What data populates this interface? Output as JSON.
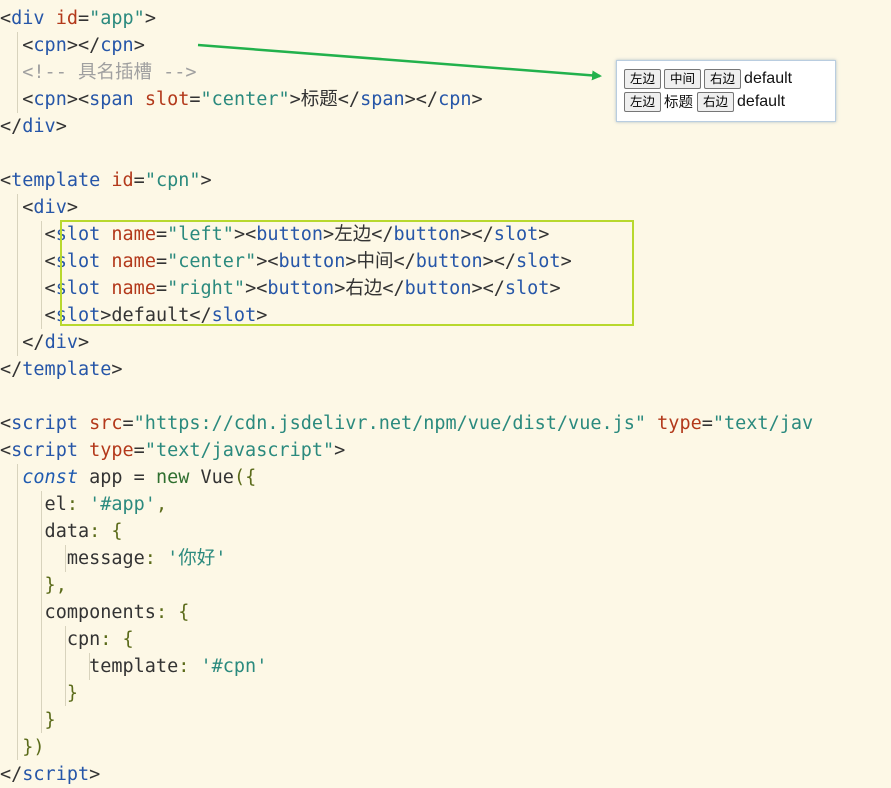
{
  "code_lines": [
    [
      [
        "p",
        "<"
      ],
      [
        "t",
        "div"
      ],
      [
        "p",
        " "
      ],
      [
        "a",
        "id"
      ],
      [
        "p",
        "="
      ],
      [
        "s",
        "\"app\""
      ],
      [
        "p",
        ">"
      ]
    ],
    [
      [
        "p",
        "  <"
      ],
      [
        "t",
        "cpn"
      ],
      [
        "p",
        "></"
      ],
      [
        "t",
        "cpn"
      ],
      [
        "p",
        ">"
      ]
    ],
    [
      [
        "c",
        "  <!-- 具名插槽 -->"
      ]
    ],
    [
      [
        "p",
        "  <"
      ],
      [
        "t",
        "cpn"
      ],
      [
        "p",
        "><"
      ],
      [
        "t",
        "span"
      ],
      [
        "p",
        " "
      ],
      [
        "a",
        "slot"
      ],
      [
        "p",
        "="
      ],
      [
        "s",
        "\"center\""
      ],
      [
        "p",
        ">"
      ],
      [
        "n",
        "标题"
      ],
      [
        "p",
        "</"
      ],
      [
        "t",
        "span"
      ],
      [
        "p",
        "></"
      ],
      [
        "t",
        "cpn"
      ],
      [
        "p",
        ">"
      ]
    ],
    [
      [
        "p",
        "</"
      ],
      [
        "t",
        "div"
      ],
      [
        "p",
        ">"
      ]
    ],
    [],
    [
      [
        "p",
        "<"
      ],
      [
        "t",
        "template"
      ],
      [
        "p",
        " "
      ],
      [
        "a",
        "id"
      ],
      [
        "p",
        "="
      ],
      [
        "s",
        "\"cpn\""
      ],
      [
        "p",
        ">"
      ]
    ],
    [
      [
        "p",
        "  <"
      ],
      [
        "t",
        "div"
      ],
      [
        "p",
        ">"
      ]
    ],
    [
      [
        "p",
        "    <"
      ],
      [
        "t",
        "slot"
      ],
      [
        "p",
        " "
      ],
      [
        "a",
        "name"
      ],
      [
        "p",
        "="
      ],
      [
        "s",
        "\"left\""
      ],
      [
        "p",
        "><"
      ],
      [
        "t",
        "button"
      ],
      [
        "p",
        ">"
      ],
      [
        "n",
        "左边"
      ],
      [
        "p",
        "</"
      ],
      [
        "t",
        "button"
      ],
      [
        "p",
        "></"
      ],
      [
        "t",
        "slot"
      ],
      [
        "p",
        ">"
      ]
    ],
    [
      [
        "p",
        "    <"
      ],
      [
        "t",
        "slot"
      ],
      [
        "p",
        " "
      ],
      [
        "a",
        "name"
      ],
      [
        "p",
        "="
      ],
      [
        "s",
        "\"center\""
      ],
      [
        "p",
        "><"
      ],
      [
        "t",
        "button"
      ],
      [
        "p",
        ">"
      ],
      [
        "n",
        "中间"
      ],
      [
        "p",
        "</"
      ],
      [
        "t",
        "button"
      ],
      [
        "p",
        "></"
      ],
      [
        "t",
        "slot"
      ],
      [
        "p",
        ">"
      ]
    ],
    [
      [
        "p",
        "    <"
      ],
      [
        "t",
        "slot"
      ],
      [
        "p",
        " "
      ],
      [
        "a",
        "name"
      ],
      [
        "p",
        "="
      ],
      [
        "s",
        "\"right\""
      ],
      [
        "p",
        "><"
      ],
      [
        "t",
        "button"
      ],
      [
        "p",
        ">"
      ],
      [
        "n",
        "右边"
      ],
      [
        "p",
        "</"
      ],
      [
        "t",
        "button"
      ],
      [
        "p",
        "></"
      ],
      [
        "t",
        "slot"
      ],
      [
        "p",
        ">"
      ]
    ],
    [
      [
        "p",
        "    <"
      ],
      [
        "t",
        "slot"
      ],
      [
        "p",
        ">"
      ],
      [
        "n",
        "default"
      ],
      [
        "p",
        "</"
      ],
      [
        "t",
        "slot"
      ],
      [
        "p",
        ">"
      ]
    ],
    [
      [
        "p",
        "  </"
      ],
      [
        "t",
        "div"
      ],
      [
        "p",
        ">"
      ]
    ],
    [
      [
        "p",
        "</"
      ],
      [
        "t",
        "template"
      ],
      [
        "p",
        ">"
      ]
    ],
    [],
    [
      [
        "p",
        "<"
      ],
      [
        "t",
        "script"
      ],
      [
        "p",
        " "
      ],
      [
        "a",
        "src"
      ],
      [
        "p",
        "="
      ],
      [
        "s",
        "\"https://cdn.jsdelivr.net/npm/vue/dist/vue.js\""
      ],
      [
        "p",
        " "
      ],
      [
        "a",
        "type"
      ],
      [
        "p",
        "="
      ],
      [
        "s",
        "\"text/jav"
      ]
    ],
    [
      [
        "p",
        "<"
      ],
      [
        "t",
        "script"
      ],
      [
        "p",
        " "
      ],
      [
        "a",
        "type"
      ],
      [
        "p",
        "="
      ],
      [
        "s",
        "\"text/javascript\""
      ],
      [
        "p",
        ">"
      ]
    ],
    [
      [
        "p",
        "  "
      ],
      [
        "kw",
        "const"
      ],
      [
        "n",
        " app = "
      ],
      [
        "k",
        "new"
      ],
      [
        "n",
        " Vue"
      ],
      [
        "f",
        "({"
      ]
    ],
    [
      [
        "n",
        "    el"
      ],
      [
        "f",
        ": "
      ],
      [
        "s",
        "'#app'"
      ],
      [
        "f",
        ","
      ]
    ],
    [
      [
        "n",
        "    data"
      ],
      [
        "f",
        ": {"
      ]
    ],
    [
      [
        "n",
        "      message"
      ],
      [
        "f",
        ": "
      ],
      [
        "s",
        "'你好'"
      ]
    ],
    [
      [
        "f",
        "    },"
      ]
    ],
    [
      [
        "n",
        "    components"
      ],
      [
        "f",
        ": {"
      ]
    ],
    [
      [
        "n",
        "      cpn"
      ],
      [
        "f",
        ": {"
      ]
    ],
    [
      [
        "n",
        "        template"
      ],
      [
        "f",
        ": "
      ],
      [
        "s",
        "'#cpn'"
      ]
    ],
    [
      [
        "f",
        "      }"
      ]
    ],
    [
      [
        "f",
        "    }"
      ]
    ],
    [
      [
        "f",
        "  })"
      ]
    ],
    [
      [
        "p",
        "</"
      ],
      [
        "t",
        "script"
      ],
      [
        "p",
        ">"
      ]
    ]
  ],
  "preview": {
    "row1": {
      "left_button": "左边",
      "center_button": "中间",
      "right_button": "右边",
      "default_text": "default"
    },
    "row2": {
      "left_button": "左边",
      "center_text": "标题",
      "right_button": "右边",
      "default_text": "default"
    }
  },
  "colors": {
    "background": "#fdf8e6",
    "tag": "#2656a8",
    "attribute": "#b3391b",
    "string": "#2b8a7e",
    "comment": "#a0a0a0",
    "highlight_box": "#b8d82e",
    "arrow": "#22b14c"
  }
}
